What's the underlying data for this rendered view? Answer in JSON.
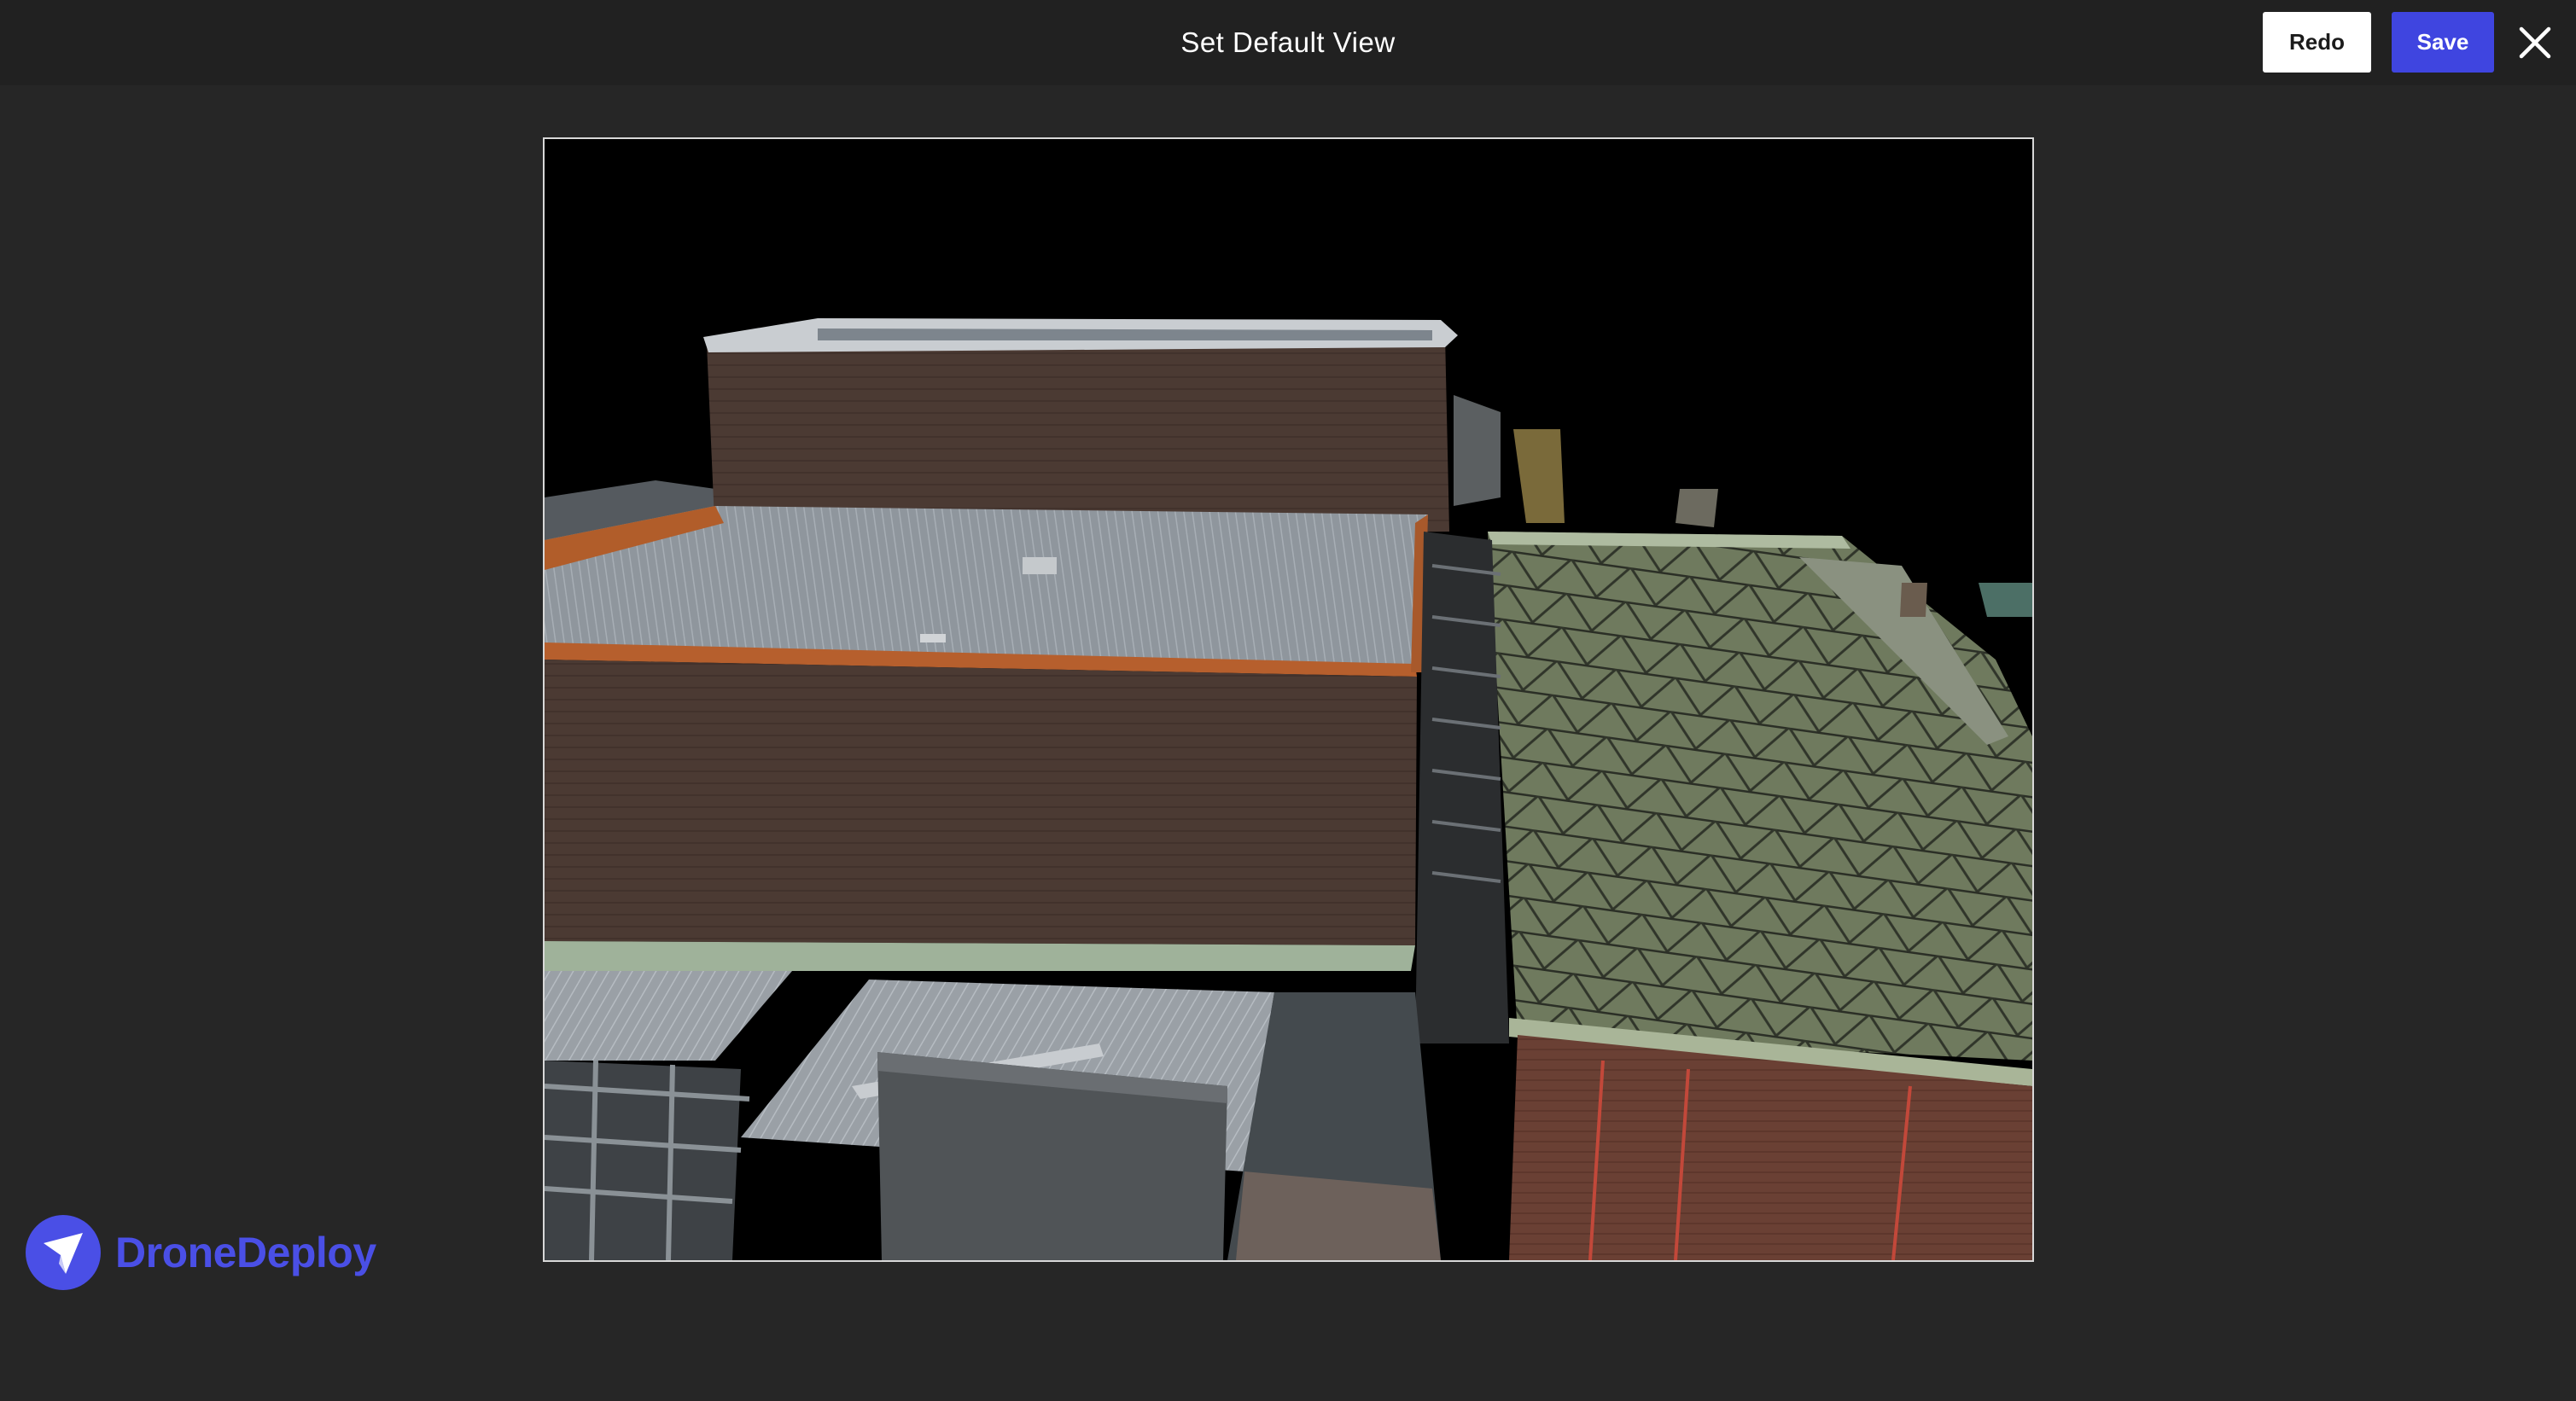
{
  "header": {
    "title": "Set Default View",
    "redo_label": "Redo",
    "save_label": "Save",
    "close_icon": "close-icon"
  },
  "viewport": {
    "content": "3d-model-preview"
  },
  "branding": {
    "logo_text": "DroneDeploy",
    "logo_icon": "dronedeploy-logo-icon",
    "brand_color": "#4a4fe6"
  },
  "colors": {
    "save_button": "#3f45e0",
    "background": "#262626",
    "topbar": "#212121"
  }
}
